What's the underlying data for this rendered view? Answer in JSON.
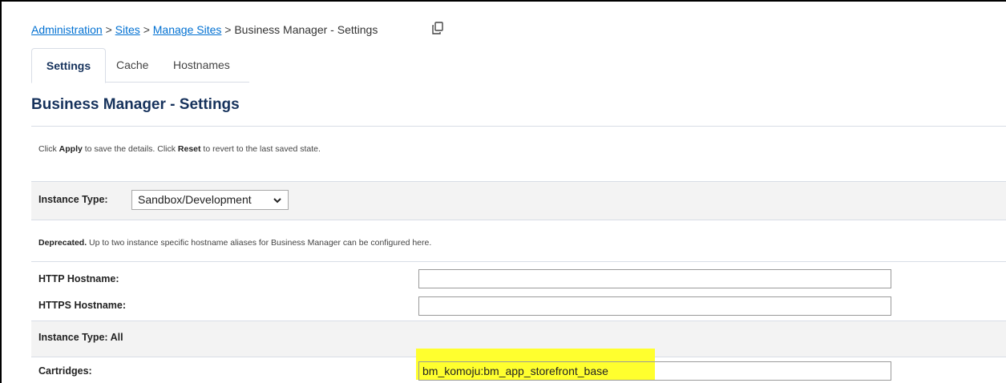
{
  "breadcrumb": {
    "items": [
      "Administration",
      "Sites",
      "Manage Sites",
      "Business Manager - Settings"
    ],
    "separator": ">"
  },
  "tabs": [
    {
      "label": "Settings",
      "active": true
    },
    {
      "label": "Cache",
      "active": false
    },
    {
      "label": "Hostnames",
      "active": false
    }
  ],
  "page_title": "Business Manager - Settings",
  "instructions": {
    "part1": "Click ",
    "apply": "Apply",
    "part2": " to save the details. Click ",
    "reset": "Reset",
    "part3": " to revert to the last saved state."
  },
  "instance_type_section": {
    "label": "Instance Type:",
    "selected": "Sandbox/Development"
  },
  "deprecated_note": {
    "bold": "Deprecated.",
    "text": " Up to two instance specific hostname aliases for Business Manager can be configured here."
  },
  "http_hostname": {
    "label": "HTTP Hostname:",
    "value": ""
  },
  "https_hostname": {
    "label": "HTTPS Hostname:",
    "value": ""
  },
  "instance_type_all": {
    "label": "Instance Type:",
    "value": "All"
  },
  "cartridges": {
    "label": "Cartridges:",
    "value": "bm_komoju:bm_app_storefront_base"
  },
  "colors": {
    "link": "#0070d2",
    "title": "#16325c",
    "highlight": "#ffff2e",
    "section_bg": "#f3f3f3"
  },
  "icons": {
    "copy": "copy-icon",
    "dropdown": "chevron-down-icon"
  }
}
